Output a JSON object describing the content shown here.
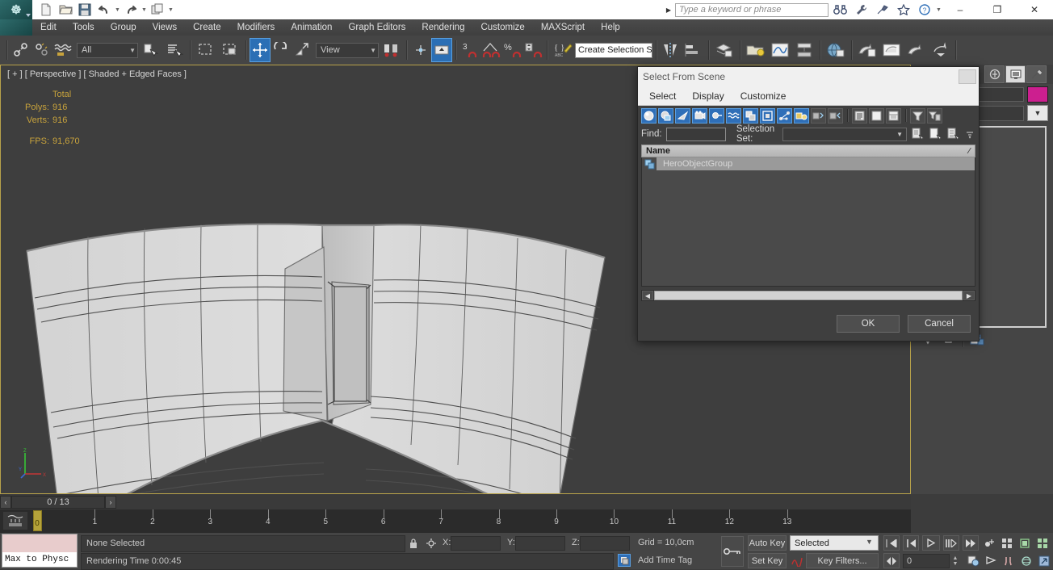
{
  "app": {
    "title_search_placeholder": "Type a keyword or phrase"
  },
  "quick_access": [
    {
      "name": "new-file",
      "icon": "new-file-icon"
    },
    {
      "name": "open-file",
      "icon": "open-folder-icon"
    },
    {
      "name": "save-file",
      "icon": "save-disk-icon"
    },
    {
      "name": "undo",
      "icon": "undo-arrow-icon"
    },
    {
      "name": "redo",
      "icon": "redo-arrow-icon"
    },
    {
      "name": "set-project-folder",
      "icon": "project-folder-icon"
    }
  ],
  "title_buttons": {
    "search_icon": "binoculars-icon",
    "wrench_icon": "wrench-icon",
    "tool_icon": "tool-icon",
    "star_icon": "star-icon",
    "help_icon": "help-icon",
    "minimize": "–",
    "maximize": "❐",
    "close": "✕"
  },
  "menu": {
    "items": [
      {
        "label": "Edit"
      },
      {
        "label": "Tools"
      },
      {
        "label": "Group"
      },
      {
        "label": "Views"
      },
      {
        "label": "Create"
      },
      {
        "label": "Modifiers"
      },
      {
        "label": "Animation"
      },
      {
        "label": "Graph Editors"
      },
      {
        "label": "Rendering"
      },
      {
        "label": "Customize"
      },
      {
        "label": "MAXScript"
      },
      {
        "label": "Help"
      }
    ]
  },
  "toolbar": {
    "selection_filter_value": "All",
    "reference_coord_value": "View",
    "named_selection_value": "Create Selection Se",
    "angle_snap_label": "3",
    "percent_snap_label": "%"
  },
  "viewport": {
    "label": "[ + ] [ Perspective ] [ Shaded + Edged Faces ]",
    "stats": {
      "header": "Total",
      "polys_label": "Polys:",
      "polys_value": "916",
      "verts_label": "Verts:",
      "verts_value": "916",
      "fps_label": "FPS:",
      "fps_value": "91,670"
    },
    "axis": {
      "x": "X",
      "y": "Y",
      "z": "Z"
    },
    "accent_border": "#b8a24a",
    "background": "#3e3e3e"
  },
  "command_panel": {
    "tabs": [
      {
        "name": "create-tab",
        "icon": "create-arrow-icon",
        "selected": false
      },
      {
        "name": "modify-tab",
        "icon": "modify-monitor-icon",
        "selected": true
      },
      {
        "name": "hierarchy-tab",
        "icon": "hammer-icon",
        "selected": false
      }
    ],
    "object_color": "#cc1f8f",
    "name_value": "",
    "modifier_value": ""
  },
  "timeline": {
    "frame_indicator": "0 / 13",
    "prev_label": "‹",
    "next_label": "›",
    "current_frame": 0,
    "frames": [
      0,
      1,
      2,
      3,
      4,
      5,
      6,
      7,
      8,
      9,
      10,
      11,
      12,
      13
    ]
  },
  "status_bar": {
    "max_to_physical_label": "Max to Physc",
    "selection_status": "None Selected",
    "rendering_time": "Rendering Time  0:00:45",
    "x_label": "X:",
    "y_label": "Y:",
    "z_label": "Z:",
    "x_value": "",
    "y_value": "",
    "z_value": "",
    "grid_label": "Grid = 10,0cm",
    "add_time_tag": "Add Time Tag",
    "auto_key": "Auto Key",
    "set_key": "Set Key",
    "key_mode_value": "Selected",
    "key_filters": "Key Filters...",
    "current_frame_value": "0",
    "lock_icon": "lock-icon",
    "key_icon": "key-icon"
  },
  "dialog": {
    "title": "Select From Scene",
    "menu": [
      {
        "label": "Select"
      },
      {
        "label": "Display"
      },
      {
        "label": "Customize"
      }
    ],
    "filter_tools": [
      {
        "name": "display-all-button",
        "icon": "sphere-icon",
        "active": true
      },
      {
        "name": "display-none-button",
        "icon": "none-icon",
        "active": true
      },
      {
        "name": "display-geometry-button",
        "icon": "geometry-icon",
        "active": true
      },
      {
        "name": "display-cameras-button",
        "icon": "camera-icon",
        "active": true
      },
      {
        "name": "display-lights-button",
        "icon": "light-icon",
        "active": true
      },
      {
        "name": "display-space-warps-button",
        "icon": "wave-icon",
        "active": true
      },
      {
        "name": "display-groups-button",
        "icon": "group-icon",
        "active": true
      },
      {
        "name": "display-xrefs-button",
        "icon": "xref-icon",
        "active": true
      },
      {
        "name": "display-bones-button",
        "icon": "bone-icon",
        "active": true
      },
      {
        "name": "display-children-button",
        "icon": "children-icon",
        "active": true
      },
      {
        "name": "display-influences-button",
        "icon": "influences-icon",
        "active": false
      },
      {
        "name": "display-dependents-button",
        "icon": "dependents-icon",
        "active": false
      },
      {
        "name": "expand-all-button",
        "icon": "list-lines-icon",
        "active": false
      },
      {
        "name": "collapse-all-button",
        "icon": "blank-page-icon",
        "active": false
      },
      {
        "name": "expand-selected-button",
        "icon": "split-page-icon",
        "active": false
      },
      {
        "name": "filter-button",
        "icon": "funnel-icon",
        "active": false
      },
      {
        "name": "advanced-filter-button",
        "icon": "funnel-list-icon",
        "active": false
      }
    ],
    "find_label": "Find:",
    "find_value": "",
    "selection_set_label": "Selection Set:",
    "selection_set_value": "",
    "column_header": "Name",
    "sort_mark": "⁄",
    "items": [
      {
        "name": "HeroObjectGroup",
        "icon": "group-node-icon",
        "selected": true
      }
    ],
    "ok_label": "OK",
    "cancel_label": "Cancel"
  }
}
